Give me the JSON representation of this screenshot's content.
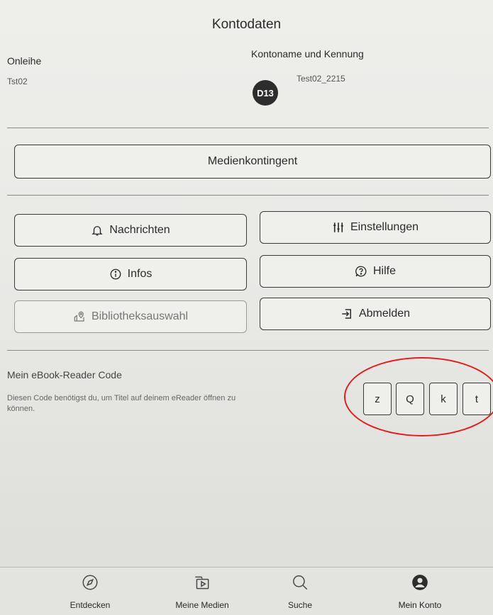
{
  "header": {
    "title": "Kontodaten"
  },
  "account": {
    "library_label": "Onleihe",
    "library_value": "Tst02",
    "name_label": "Kontoname und Kennung",
    "avatar_initials": "D13",
    "account_id": "Test02_2215"
  },
  "buttons": {
    "quota": "Medienkontingent",
    "messages": "Nachrichten",
    "settings": "Einstellungen",
    "info": "Infos",
    "help": "Hilfe",
    "library_select": "Bibliotheksauswahl",
    "logout": "Abmelden"
  },
  "reader_code": {
    "title": "Mein eBook-Reader Code",
    "description": "Diesen Code benötigst du, um Titel auf deinem eReader öffnen zu können.",
    "chars": [
      "z",
      "Q",
      "k",
      "t"
    ]
  },
  "nav": {
    "discover": "Entdecken",
    "my_media": "Meine Medien",
    "search": "Suche",
    "my_account": "Mein Konto"
  },
  "icons": {
    "messages": "bell-icon",
    "settings": "sliders-icon",
    "info": "info-circle-icon",
    "help": "question-bubble-icon",
    "library_select": "map-pin-icon",
    "logout": "logout-icon",
    "discover": "compass-icon",
    "my_media": "media-library-icon",
    "search": "search-icon",
    "my_account": "user-icon"
  },
  "colors": {
    "highlight": "#e01e1e",
    "avatar": "#2d2d2d"
  }
}
